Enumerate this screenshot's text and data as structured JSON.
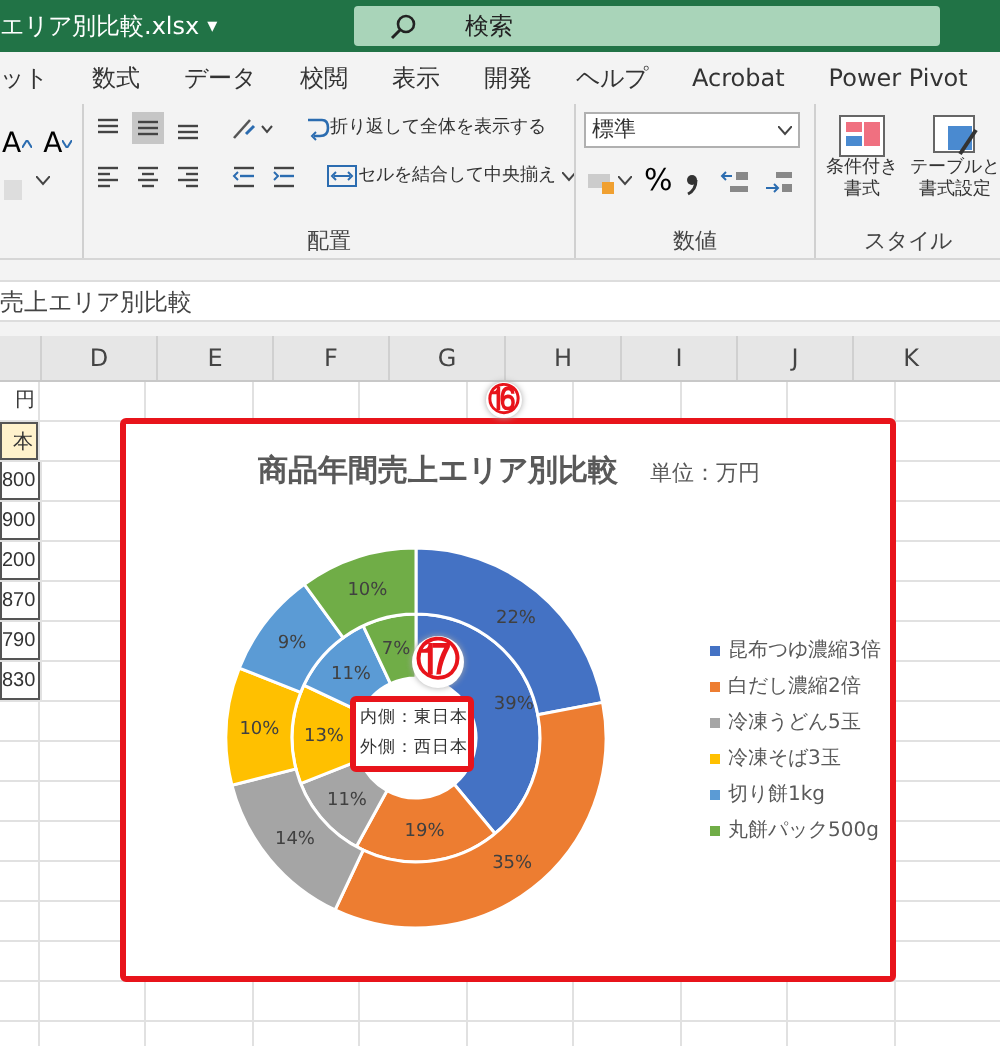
{
  "window": {
    "title": "エリア別比較.xlsx",
    "title_caret": "▾",
    "search_placeholder": "検索"
  },
  "tabs": [
    {
      "label": "ット",
      "selected": false
    },
    {
      "label": "数式",
      "selected": false
    },
    {
      "label": "データ",
      "selected": false
    },
    {
      "label": "校閲",
      "selected": false
    },
    {
      "label": "表示",
      "selected": false
    },
    {
      "label": "開発",
      "selected": false
    },
    {
      "label": "ヘルプ",
      "selected": false
    },
    {
      "label": "Acrobat",
      "selected": false
    },
    {
      "label": "Power Pivot",
      "selected": false
    }
  ],
  "ribbon": {
    "font_buttons": [
      {
        "label": "A",
        "kind": "grow"
      },
      {
        "label": "A",
        "kind": "shrink"
      }
    ],
    "vertical_align": [
      {
        "selected": false
      },
      {
        "selected": true
      },
      {
        "selected": false
      }
    ],
    "wrap_text": "折り返して全体を表示する",
    "merge_center": "セルを結合して中央揃え",
    "alignment_group": "配置",
    "number_format": "標準",
    "percent": "%",
    "number_group": "数値",
    "conditional_format": [
      "条件付き",
      "書式"
    ],
    "table_format": [
      "テーブルと",
      "書式設定"
    ],
    "styles_group": "スタイル"
  },
  "formula_bar": {
    "value": "売上エリア別比較"
  },
  "sheet": {
    "columns": [
      "D",
      "E",
      "F",
      "G",
      "H",
      "I",
      "J",
      "K"
    ],
    "column_c_cells": [
      {
        "text": "円",
        "kind": "plain"
      },
      {
        "text": "本",
        "kind": "header"
      },
      {
        "text": "800",
        "kind": "value"
      },
      {
        "text": "900",
        "kind": "value"
      },
      {
        "text": "200",
        "kind": "value"
      },
      {
        "text": "870",
        "kind": "value"
      },
      {
        "text": "790",
        "kind": "value"
      },
      {
        "text": "830",
        "kind": "value"
      }
    ]
  },
  "chart": {
    "callout": "⑯",
    "unit": "単位：万円",
    "note_callout": "⑰",
    "chart_data": {
      "type": "donut",
      "title": "商品年間売上エリア別比較",
      "categories": [
        "昆布つゆ濃縮3倍",
        "白だし濃縮2倍",
        "冷凍うどん5玉",
        "冷凍そば3玉",
        "切り餅1kg",
        "丸餅パック500g"
      ],
      "series": [
        {
          "name": "内側：東日本",
          "colors": [
            "#4472c4",
            "#ed7d31",
            "#a5a5a5",
            "#ffc000",
            "#5b9bd5",
            "#70ad47"
          ],
          "values": [
            39,
            19,
            11,
            13,
            11,
            7
          ],
          "value_labels": [
            "39%",
            "19%",
            "11%",
            "13%",
            "11%",
            "7%"
          ]
        },
        {
          "name": "外側：西日本",
          "colors": [
            "#4472c4",
            "#ed7d31",
            "#a5a5a5",
            "#ffc000",
            "#5b9bd5",
            "#70ad47"
          ],
          "values": [
            22,
            35,
            14,
            10,
            9,
            10
          ],
          "value_labels": [
            "22%",
            "35%",
            "14%",
            "10%",
            "9%",
            "10%"
          ]
        }
      ],
      "data_labels": true
    }
  }
}
